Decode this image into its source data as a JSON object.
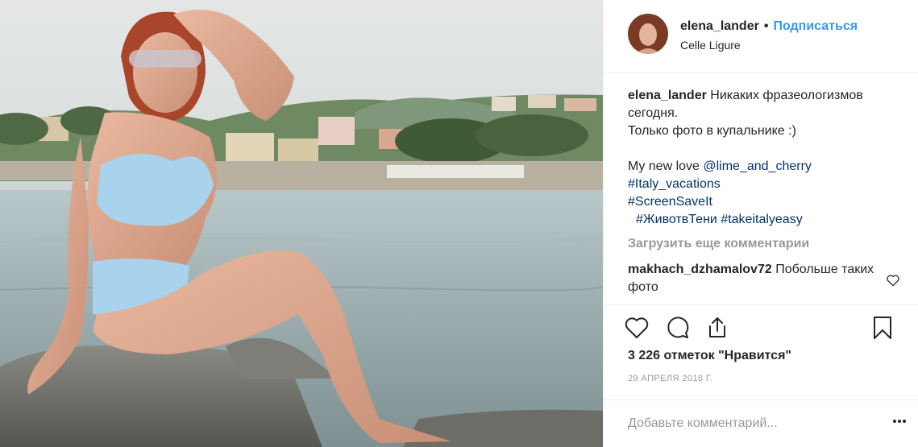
{
  "post": {
    "username": "elena_lander",
    "separator": "•",
    "follow_label": "Подписаться",
    "location": "Celle Ligure"
  },
  "caption": {
    "username": "elena_lander",
    "text": "Никаких фразеологизмов сегодня.\nТолько фото в купальнике :)",
    "line2_prefix": "My new love ",
    "mention": "@lime_and_cherry",
    "hashtags": [
      "#Italy_vacations",
      "#ScreenSaveIt",
      "#ЖивотвТени",
      "#takeitalyeasy"
    ]
  },
  "load_more_label": "Загрузить еще комментарии",
  "comment": {
    "username": "makhach_dzhamalov72",
    "text": "Побольше таких фото"
  },
  "icons": {
    "like": "heart-icon",
    "comment": "comment-bubble-icon",
    "share": "share-icon",
    "save": "bookmark-icon",
    "comment_like": "small-heart-icon",
    "more": "more-options-icon"
  },
  "likes_label": "3 226 отметок \"Нравится\"",
  "date": "29 апреля 2018 г.",
  "add_comment_placeholder": "Добавьте комментарий...",
  "colors": {
    "link": "#3897f0",
    "hashtag": "#003569",
    "muted": "#999999",
    "text": "#262626"
  }
}
